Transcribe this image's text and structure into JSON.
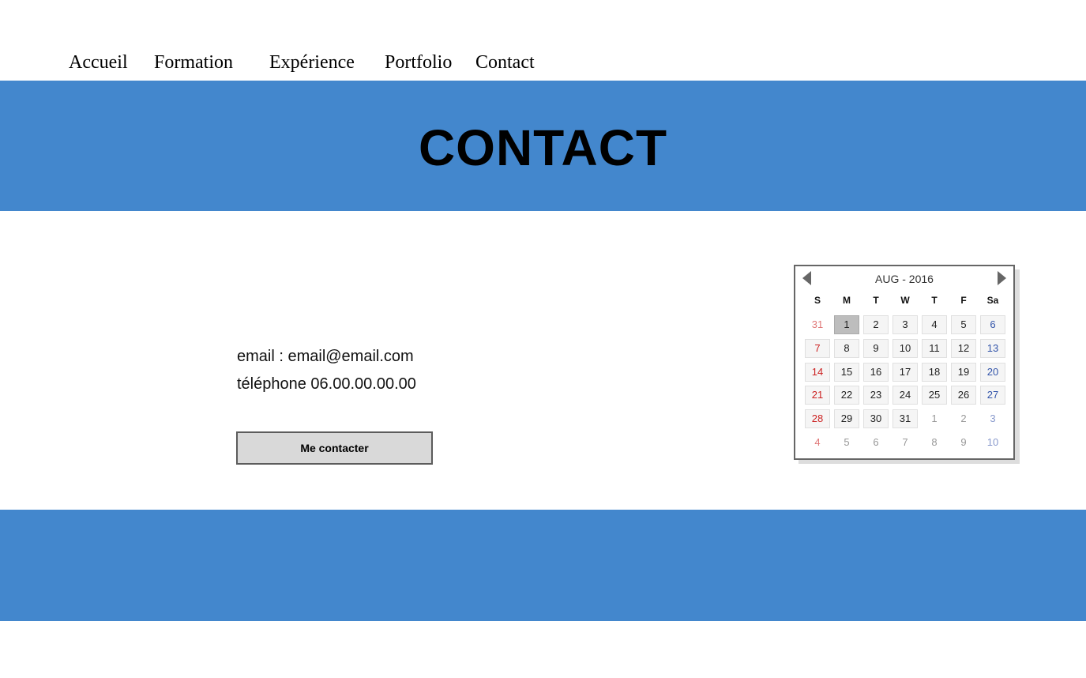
{
  "nav": {
    "items": [
      {
        "label": "Accueil"
      },
      {
        "label": "Formation"
      },
      {
        "label": "Expérience"
      },
      {
        "label": "Portfolio"
      },
      {
        "label": "Contact"
      }
    ]
  },
  "hero": {
    "title": "CONTACT"
  },
  "contact": {
    "email_line": "email : email@email.com",
    "phone_line": "téléphone 06.00.00.00.00",
    "button_label": "Me contacter"
  },
  "calendar": {
    "title": "AUG - 2016",
    "weekdays": [
      "S",
      "M",
      "T",
      "W",
      "T",
      "F",
      "Sa"
    ],
    "selected_day": "1",
    "weeks": [
      [
        "31",
        "1",
        "2",
        "3",
        "4",
        "5",
        "6"
      ],
      [
        "7",
        "8",
        "9",
        "10",
        "11",
        "12",
        "13"
      ],
      [
        "14",
        "15",
        "16",
        "17",
        "18",
        "19",
        "20"
      ],
      [
        "21",
        "22",
        "23",
        "24",
        "25",
        "26",
        "27"
      ],
      [
        "28",
        "29",
        "30",
        "31",
        "1",
        "2",
        "3"
      ],
      [
        "4",
        "5",
        "6",
        "7",
        "8",
        "9",
        "10"
      ]
    ],
    "colors": {
      "sunday": "#cc2222",
      "saturday": "#3355aa",
      "selected": "#bdbdbd"
    }
  },
  "colors": {
    "band": "#4387cd"
  }
}
